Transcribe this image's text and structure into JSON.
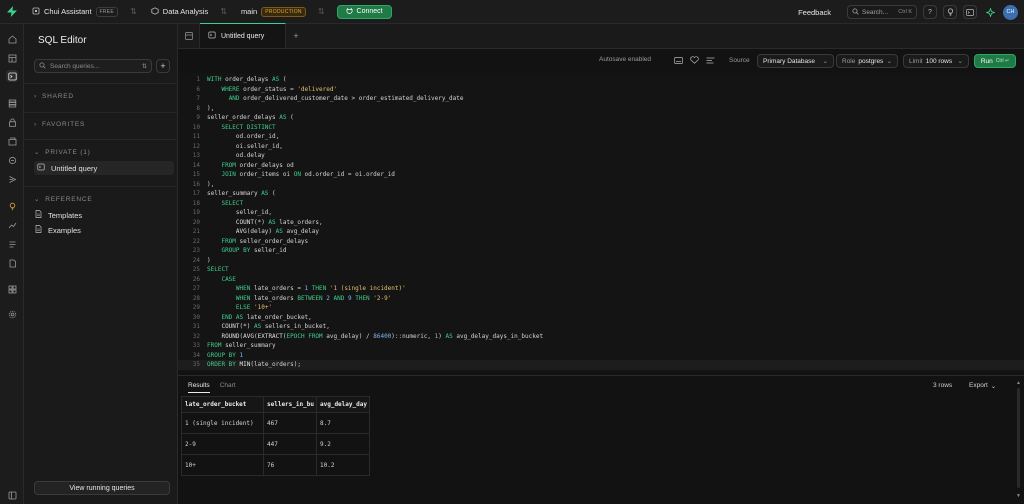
{
  "topbar": {
    "org_name": "Chui Assistant",
    "org_plan": "FREE",
    "project_name": "Data Analysis",
    "branch_name": "main",
    "branch_env": "PRODUCTION",
    "connect_label": "Connect",
    "feedback_label": "Feedback",
    "search_placeholder": "Search...",
    "search_shortcut": "Ctrl K",
    "avatar_initials": "CH"
  },
  "sidebar": {
    "title": "SQL Editor",
    "search_placeholder": "Search queries...",
    "sections": {
      "shared": "SHARED",
      "favorites": "FAVORITES",
      "private": "PRIVATE (1)",
      "reference": "REFERENCE"
    },
    "private_items": [
      "Untitled query"
    ],
    "reference_items": [
      "Templates",
      "Examples"
    ],
    "bottom_button": "View running queries"
  },
  "tabs": [
    {
      "label": "Untitled query",
      "active": true
    }
  ],
  "toolbar": {
    "autosave": "Autosave enabled",
    "source_label": "Source",
    "source_value": "Primary Database",
    "role_label": "Role",
    "role_value": "postgres",
    "limit_label": "Limit",
    "limit_value": "100 rows",
    "run_label": "Run",
    "run_shortcut": "Ctrl ↵"
  },
  "editor": {
    "lines": [
      {
        "n": "1",
        "html": "<span class='kw'>WITH</span> order_delays <span class='kw'>AS</span> ("
      },
      {
        "n": "6",
        "html": "    <span class='kw'>WHERE</span> order_status = <span class='str'>'delivered'</span>"
      },
      {
        "n": "7",
        "html": "      <span class='kw'>AND</span> order_delivered_customer_date &gt; order_estimated_delivery_date"
      },
      {
        "n": "8",
        "html": "),"
      },
      {
        "n": "9",
        "html": "seller_order_delays <span class='kw'>AS</span> ("
      },
      {
        "n": "10",
        "html": "    <span class='kw'>SELECT DISTINCT</span>"
      },
      {
        "n": "11",
        "html": "        od.order_id,"
      },
      {
        "n": "12",
        "html": "        oi.seller_id,"
      },
      {
        "n": "13",
        "html": "        od.delay"
      },
      {
        "n": "14",
        "html": "    <span class='kw'>FROM</span> order_delays od"
      },
      {
        "n": "15",
        "html": "    <span class='kw'>JOIN</span> order_items oi <span class='kw'>ON</span> od.order_id = oi.order_id"
      },
      {
        "n": "16",
        "html": "),"
      },
      {
        "n": "17",
        "html": "seller_summary <span class='kw'>AS</span> ("
      },
      {
        "n": "18",
        "html": "    <span class='kw'>SELECT</span>"
      },
      {
        "n": "19",
        "html": "        seller_id,"
      },
      {
        "n": "20",
        "html": "        <span class='fn'>COUNT</span>(*) <span class='kw'>AS</span> late_orders,"
      },
      {
        "n": "21",
        "html": "        <span class='fn'>AVG</span>(delay) <span class='kw'>AS</span> avg_delay"
      },
      {
        "n": "22",
        "html": "    <span class='kw'>FROM</span> seller_order_delays"
      },
      {
        "n": "23",
        "html": "    <span class='kw'>GROUP BY</span> seller_id"
      },
      {
        "n": "24",
        "html": ")"
      },
      {
        "n": "25",
        "html": "<span class='kw'>SELECT</span>"
      },
      {
        "n": "26",
        "html": "    <span class='kw'>CASE</span>"
      },
      {
        "n": "27",
        "html": "        <span class='kw'>WHEN</span> late_orders = <span class='num'>1</span> <span class='kw'>THEN</span> <span class='str'>'1 (single incident)'</span>"
      },
      {
        "n": "28",
        "html": "        <span class='kw'>WHEN</span> late_orders <span class='kw'>BETWEEN</span> <span class='num'>2</span> <span class='kw'>AND</span> <span class='num'>9</span> <span class='kw'>THEN</span> <span class='str'>'2-9'</span>"
      },
      {
        "n": "29",
        "html": "        <span class='kw'>ELSE</span> <span class='str'>'10+'</span>"
      },
      {
        "n": "30",
        "html": "    <span class='kw'>END AS</span> late_order_bucket,"
      },
      {
        "n": "31",
        "html": "    <span class='fn'>COUNT</span>(*) <span class='kw'>AS</span> sellers_in_bucket,"
      },
      {
        "n": "32",
        "html": "    <span class='fn'>ROUND</span>(<span class='fn'>AVG</span>(<span class='fn'>EXTRACT</span>(<span class='kw'>EPOCH FROM</span> avg_delay) / <span class='num'>86400</span>)::numeric, <span class='num'>1</span>) <span class='kw'>AS</span> avg_delay_days_in_bucket"
      },
      {
        "n": "33",
        "html": "<span class='kw'>FROM</span> seller_summary"
      },
      {
        "n": "34",
        "html": "<span class='kw'>GROUP BY</span> <span class='num'>1</span>"
      },
      {
        "n": "35",
        "html": "<span class='kw'>ORDER BY</span> <span class='fn'>MIN</span>(late_orders);"
      }
    ]
  },
  "results": {
    "tabs": [
      "Results",
      "Chart"
    ],
    "row_count": "3 rows",
    "export_label": "Export",
    "columns": [
      "late_order_bucket",
      "sellers_in_bu",
      "avg_delay_day"
    ],
    "rows": [
      [
        "1 (single incident)",
        "467",
        "8.7"
      ],
      [
        "2-9",
        "447",
        "9.2"
      ],
      [
        "10+",
        "76",
        "10.2"
      ]
    ]
  }
}
